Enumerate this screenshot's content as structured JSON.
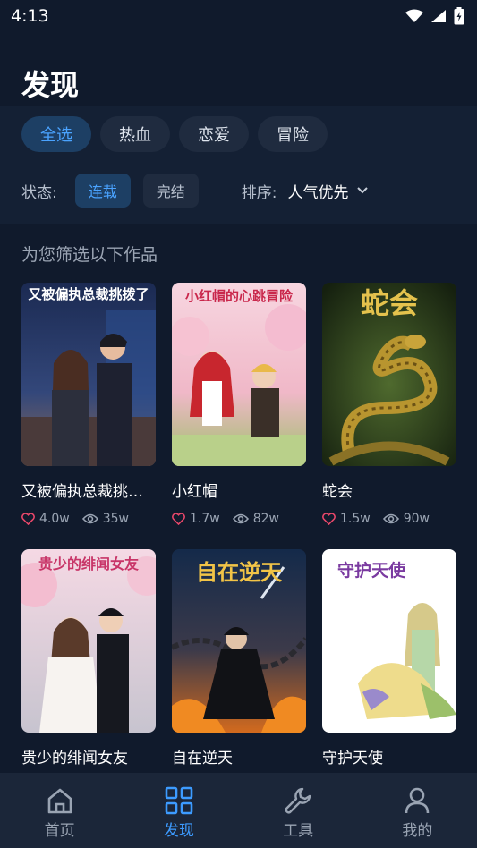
{
  "status_bar": {
    "time": "4:13"
  },
  "page_title": "发现",
  "genre_tabs": [
    {
      "label": "全选",
      "active": true
    },
    {
      "label": "热血",
      "active": false
    },
    {
      "label": "恋爱",
      "active": false
    },
    {
      "label": "冒险",
      "active": false
    }
  ],
  "status_filter": {
    "label": "状态:",
    "options": [
      {
        "label": "连载",
        "active": true
      },
      {
        "label": "完结",
        "active": false
      }
    ]
  },
  "sort": {
    "label": "排序:",
    "value": "人气优先"
  },
  "section_title": "为您筛选以下作品",
  "books": [
    {
      "title": "又被偏执总裁挑拨了",
      "cover_text": "又被偏执总裁挑拨了",
      "likes": "4.0w",
      "views": "35w"
    },
    {
      "title": "小红帽",
      "cover_text": "小红帽的心跳冒险",
      "likes": "1.7w",
      "views": "82w"
    },
    {
      "title": "蛇会",
      "cover_text": "蛇会",
      "likes": "1.5w",
      "views": "90w"
    },
    {
      "title": "贵少的绯闻女友",
      "cover_text": "贵少的绯闻女友"
    },
    {
      "title": "自在逆天",
      "cover_text": "自在逆天"
    },
    {
      "title": "守护天使",
      "cover_text": "守护天使"
    }
  ],
  "bottom_nav": [
    {
      "label": "首页",
      "icon": "home-icon",
      "active": false
    },
    {
      "label": "发现",
      "icon": "grid-icon",
      "active": true
    },
    {
      "label": "工具",
      "icon": "wrench-icon",
      "active": false
    },
    {
      "label": "我的",
      "icon": "person-icon",
      "active": false
    }
  ],
  "colors": {
    "background": "#101a2c",
    "panel": "#142034",
    "chip": "#1f2b3f",
    "chip_active_bg": "#1d3f64",
    "accent": "#3d9bff",
    "heart": "#e8476a"
  }
}
